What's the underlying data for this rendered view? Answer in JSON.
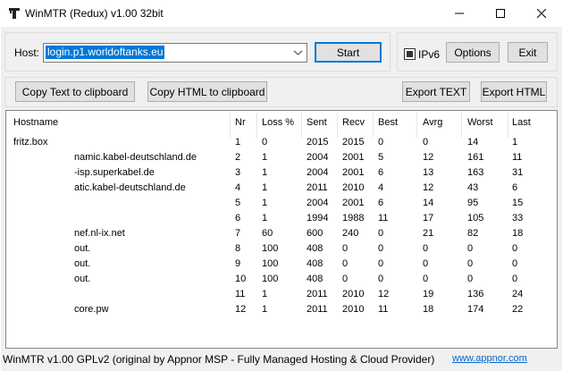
{
  "window": {
    "title": "WinMTR (Redux) v1.00 32bit",
    "minimize_icon": "minimize-icon",
    "maximize_icon": "maximize-icon",
    "close_icon": "close-icon"
  },
  "host": {
    "label": "Host:",
    "value": "login.p1.worldoftanks.eu",
    "start_label": "Start"
  },
  "options": {
    "ipv6_label": "IPv6",
    "ipv6_checked": true,
    "options_label": "Options",
    "exit_label": "Exit"
  },
  "export": {
    "copy_text_label": "Copy Text to clipboard",
    "copy_html_label": "Copy HTML to clipboard",
    "export_text_label": "Export TEXT",
    "export_html_label": "Export HTML"
  },
  "table": {
    "headers": {
      "hostname": "Hostname",
      "nr": "Nr",
      "loss": "Loss %",
      "sent": "Sent",
      "recv": "Recv",
      "best": "Best",
      "avrg": "Avrg",
      "worst": "Worst",
      "last": "Last"
    },
    "rows": [
      {
        "hostname": "fritz.box",
        "nr": "1",
        "loss": "0",
        "sent": "2015",
        "recv": "2015",
        "best": "0",
        "avrg": "0",
        "worst": "14",
        "last": "1"
      },
      {
        "hostname": "namic.kabel-deutschland.de",
        "nr": "2",
        "loss": "1",
        "sent": "2004",
        "recv": "2001",
        "best": "5",
        "avrg": "12",
        "worst": "161",
        "last": "11"
      },
      {
        "hostname": "-isp.superkabel.de",
        "nr": "3",
        "loss": "1",
        "sent": "2004",
        "recv": "2001",
        "best": "6",
        "avrg": "13",
        "worst": "163",
        "last": "31"
      },
      {
        "hostname": "atic.kabel-deutschland.de",
        "nr": "4",
        "loss": "1",
        "sent": "2011",
        "recv": "2010",
        "best": "4",
        "avrg": "12",
        "worst": "43",
        "last": "6"
      },
      {
        "hostname": "",
        "nr": "5",
        "loss": "1",
        "sent": "2004",
        "recv": "2001",
        "best": "6",
        "avrg": "14",
        "worst": "95",
        "last": "15"
      },
      {
        "hostname": "",
        "nr": "6",
        "loss": "1",
        "sent": "1994",
        "recv": "1988",
        "best": "11",
        "avrg": "17",
        "worst": "105",
        "last": "33"
      },
      {
        "hostname": "nef.nl-ix.net",
        "nr": "7",
        "loss": "60",
        "sent": "600",
        "recv": "240",
        "best": "0",
        "avrg": "21",
        "worst": "82",
        "last": "18"
      },
      {
        "hostname": "out.",
        "nr": "8",
        "loss": "100",
        "sent": "408",
        "recv": "0",
        "best": "0",
        "avrg": "0",
        "worst": "0",
        "last": "0"
      },
      {
        "hostname": "out.",
        "nr": "9",
        "loss": "100",
        "sent": "408",
        "recv": "0",
        "best": "0",
        "avrg": "0",
        "worst": "0",
        "last": "0"
      },
      {
        "hostname": "out.",
        "nr": "10",
        "loss": "100",
        "sent": "408",
        "recv": "0",
        "best": "0",
        "avrg": "0",
        "worst": "0",
        "last": "0"
      },
      {
        "hostname": "",
        "nr": "11",
        "loss": "1",
        "sent": "2011",
        "recv": "2010",
        "best": "12",
        "avrg": "19",
        "worst": "136",
        "last": "24"
      },
      {
        "hostname": "core.pw",
        "nr": "12",
        "loss": "1",
        "sent": "2011",
        "recv": "2010",
        "best": "11",
        "avrg": "18",
        "worst": "174",
        "last": "22"
      }
    ]
  },
  "status": {
    "text": "WinMTR v1.00 GPLv2 (original by Appnor MSP - Fully Managed Hosting & Cloud Provider)",
    "link": "www.appnor.com"
  },
  "colors": {
    "selection": "#0078d7",
    "link": "#0066cc",
    "panel_bg": "#f0f0f0"
  }
}
